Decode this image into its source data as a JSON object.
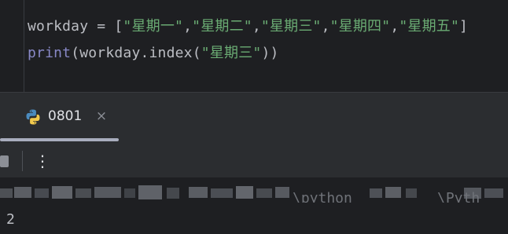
{
  "editor": {
    "line1": {
      "var": "workday",
      "assign": " = [",
      "items": [
        "\"星期一\"",
        "\"星期二\"",
        "\"星期三\"",
        "\"星期四\"",
        "\"星期五\""
      ],
      "sep": ",",
      "close": "]"
    },
    "line2": {
      "fn": "print",
      "open": "(workday.index(",
      "arg": "\"星期三\"",
      "close": "))"
    }
  },
  "run_window": {
    "tab_label": "0801",
    "tab_icon": "python-icon",
    "close_icon": "×",
    "more_icon": "⋮",
    "console": {
      "command_visible_fragment": "\\python",
      "command_visible_fragment2": "\\Pyth",
      "output": "2"
    }
  },
  "colors": {
    "editor_bg": "#1e1f22",
    "panel_bg": "#2b2d30",
    "string": "#6aab73",
    "builtin": "#8888c6",
    "text": "#bcbec4"
  }
}
